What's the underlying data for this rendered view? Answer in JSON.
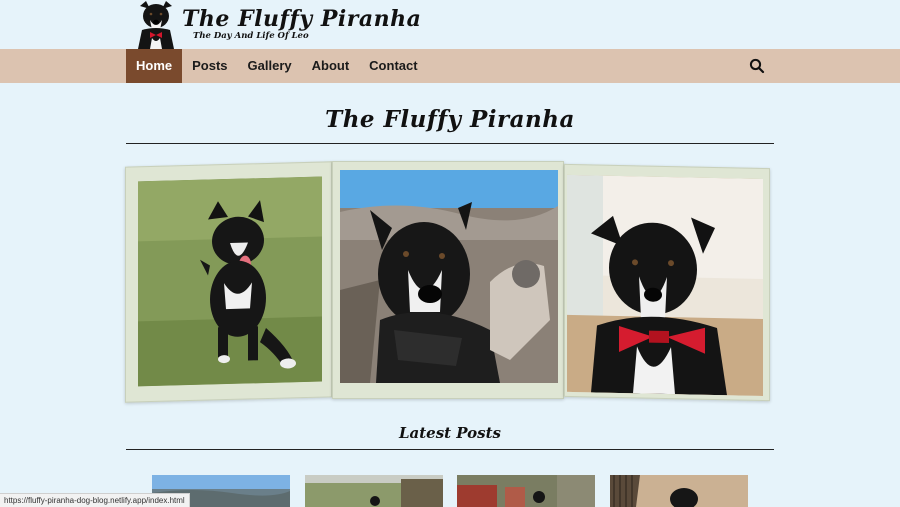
{
  "header": {
    "site_title": "The Fluffy Piranha",
    "tagline": "The Day And Life Of Leo",
    "logo_icon": "dog-with-bowtie-icon"
  },
  "nav": {
    "items": [
      {
        "label": "Home",
        "active": true
      },
      {
        "label": "Posts",
        "active": false
      },
      {
        "label": "Gallery",
        "active": false
      },
      {
        "label": "About",
        "active": false
      },
      {
        "label": "Contact",
        "active": false
      }
    ],
    "search_icon": "search-icon"
  },
  "main": {
    "title": "The Fluffy Piranha",
    "latest_posts_title": "Latest Posts"
  },
  "status_url": "https://fluffy-piranha-dog-blog.netlify.app/index.html",
  "colors": {
    "background": "#e6f3fa",
    "nav_bar": "#dcc3b0",
    "nav_active": "#7a4a2d",
    "text": "#111111"
  }
}
